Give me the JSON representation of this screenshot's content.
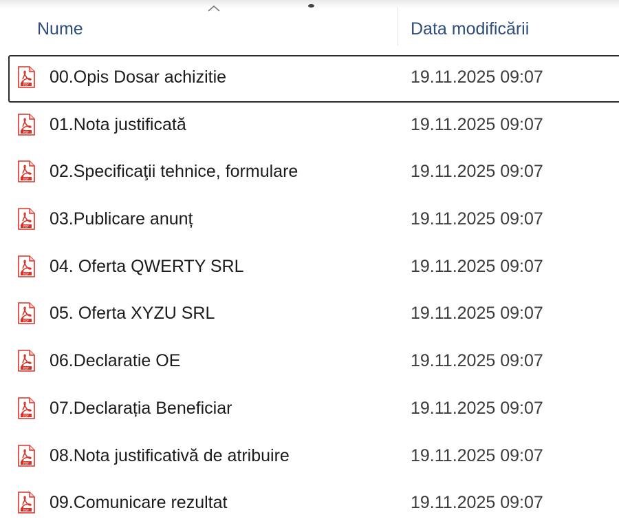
{
  "header": {
    "name_label": "Nume",
    "date_label": "Data modificării",
    "sort_direction": "ascending"
  },
  "files": [
    {
      "name": "00.Opis Dosar achizitie",
      "date": "19.11.2025 09:07",
      "icon": "pdf-file-icon",
      "selected": true
    },
    {
      "name": "01.Nota justificată",
      "date": "19.11.2025 09:07",
      "icon": "pdf-file-icon",
      "selected": false
    },
    {
      "name": "02.Specificaţii tehnice, formulare",
      "date": "19.11.2025 09:07",
      "icon": "pdf-file-icon",
      "selected": false
    },
    {
      "name": "03.Publicare anunț",
      "date": "19.11.2025 09:07",
      "icon": "pdf-file-icon",
      "selected": false
    },
    {
      "name": "04. Oferta QWERTY SRL",
      "date": "19.11.2025 09:07",
      "icon": "pdf-file-icon",
      "selected": false
    },
    {
      "name": "05. Oferta XYZU SRL",
      "date": "19.11.2025 09:07",
      "icon": "pdf-file-icon",
      "selected": false
    },
    {
      "name": "06.Declaratie OE",
      "date": "19.11.2025 09:07",
      "icon": "pdf-file-icon",
      "selected": false
    },
    {
      "name": "07.Declarația Beneficiar",
      "date": "19.11.2025 09:07",
      "icon": "pdf-file-icon",
      "selected": false
    },
    {
      "name": "08.Nota justificativă de atribuire",
      "date": "19.11.2025 09:07",
      "icon": "pdf-file-icon",
      "selected": false
    },
    {
      "name": "09.Comunicare rezultat",
      "date": "19.11.2025 09:07",
      "icon": "pdf-file-icon",
      "selected": false
    }
  ],
  "colors": {
    "header_text": "#2f4d7a",
    "pdf_icon": "#d93025",
    "selection_border": "#2b2b2b"
  }
}
